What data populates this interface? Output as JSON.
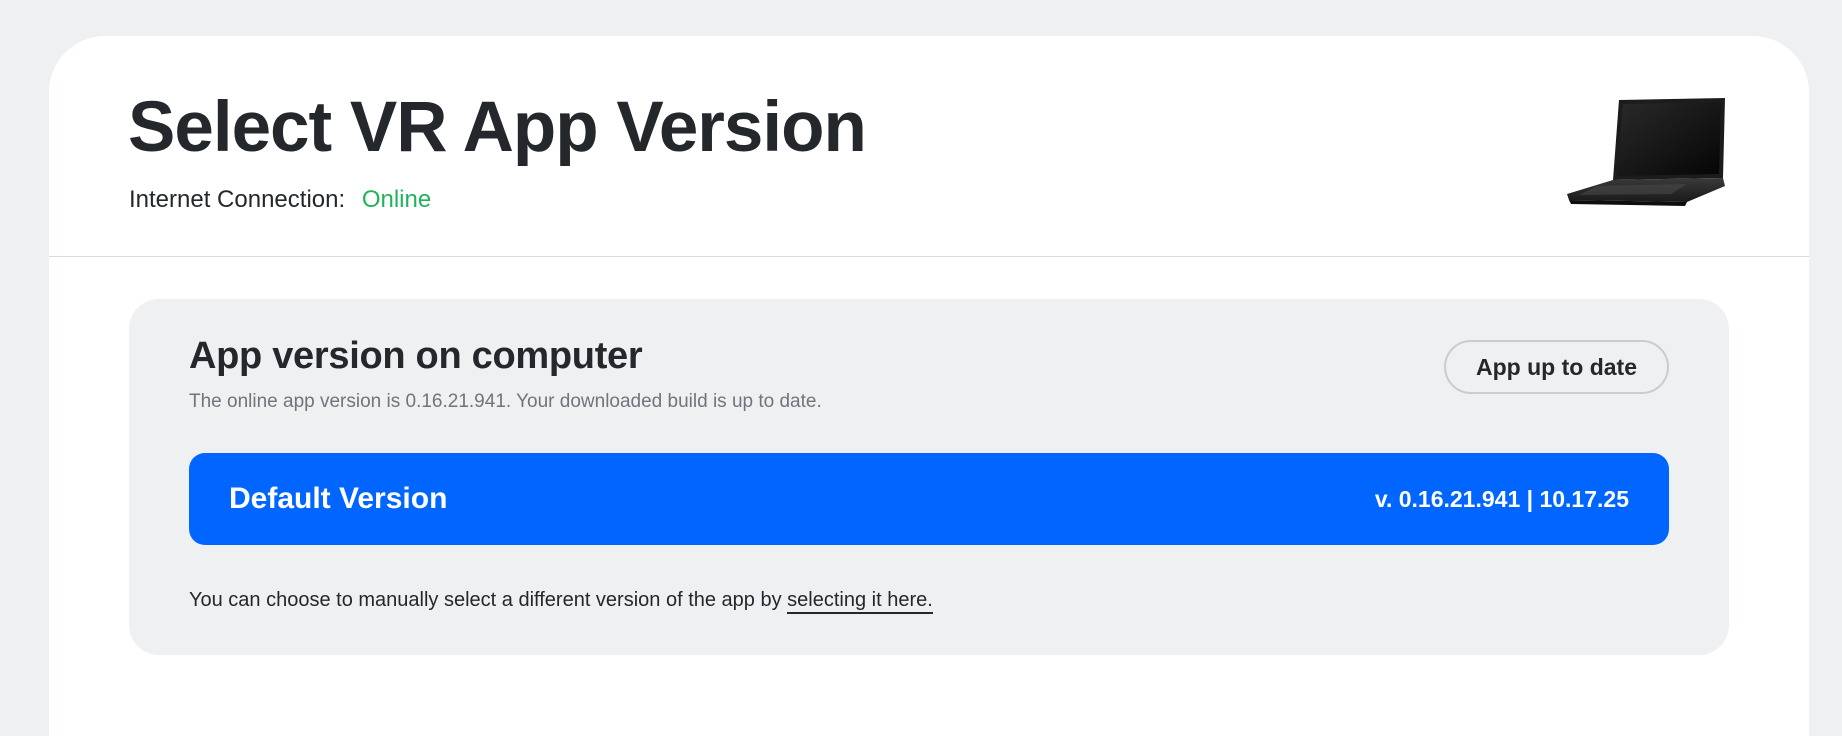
{
  "header": {
    "title": "Select VR App Version",
    "connection_label": "Internet Connection:",
    "connection_status": "Online",
    "connection_status_color": "#1fb35b",
    "device_image": "laptop-icon"
  },
  "version_panel": {
    "heading": "App version on computer",
    "description": "The online app version is 0.16.21.941. Your downloaded build is up to date.",
    "status_button_label": "App up to date",
    "default_version": {
      "name": "Default Version",
      "version_info": "v. 0.16.21.941 | 10.17.25",
      "accent_color": "#0066ff"
    },
    "manual_select_text": "You can choose to manually select a different version of the app by",
    "manual_select_link": "selecting it here."
  }
}
